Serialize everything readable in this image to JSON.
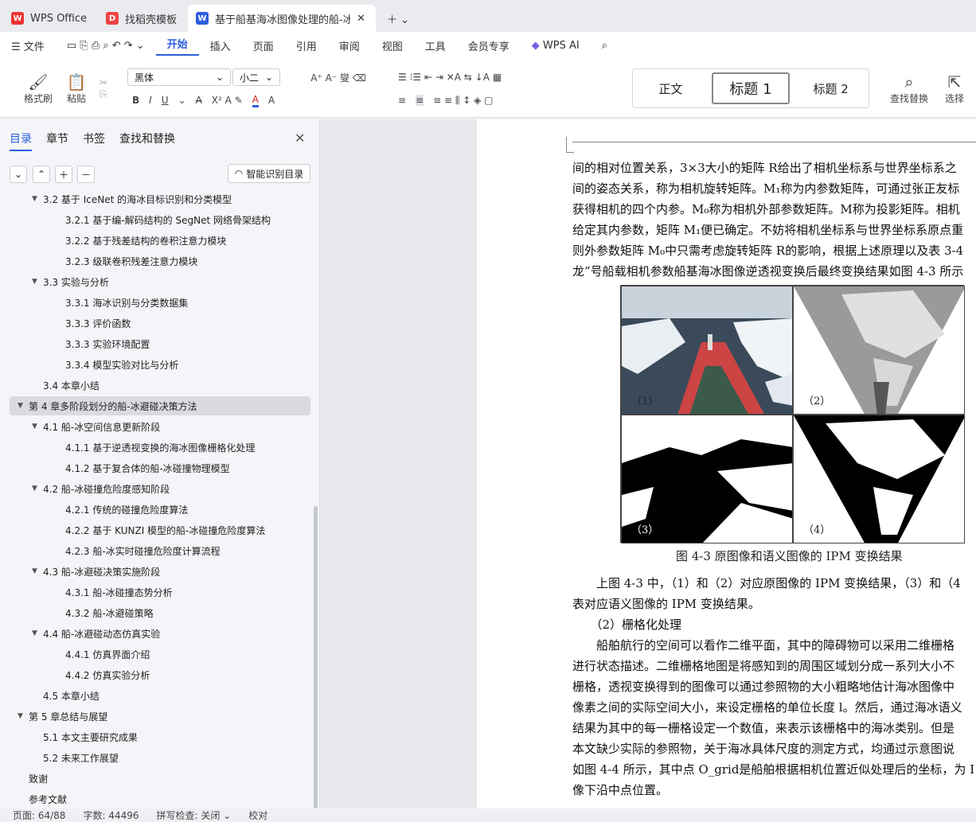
{
  "tabs": [
    {
      "label": "WPS Office"
    },
    {
      "label": "找稻壳模板"
    },
    {
      "label": "基于船基海冰图像处理的船-冰"
    }
  ],
  "menu": {
    "file": "文件",
    "items": [
      "开始",
      "插入",
      "页面",
      "引用",
      "审阅",
      "视图",
      "工具",
      "会员专享"
    ],
    "ai": "WPS AI"
  },
  "ribbon": {
    "format_painter": "格式刷",
    "paste": "粘贴",
    "font": "黑体",
    "size": "小二",
    "styles": [
      "正文",
      "标题 1",
      "标题 2"
    ],
    "find_replace": "查找替换",
    "select": "选择"
  },
  "sidebar": {
    "tabs": [
      "目录",
      "章节",
      "书签",
      "查找和替换"
    ],
    "smart": "智能识别目录",
    "items": [
      {
        "t": "3.2 基于 IceNet 的海冰目标识别和分类模型",
        "lvl": 2,
        "arr": "▼"
      },
      {
        "t": "3.2.1 基于编-解码结构的 SegNet 网络骨架结构",
        "lvl": 3
      },
      {
        "t": "3.2.2 基于残差结构的卷积注意力模块",
        "lvl": 3
      },
      {
        "t": "3.2.3 级联卷积残差注意力模块",
        "lvl": 3
      },
      {
        "t": "3.3 实验与分析",
        "lvl": 2,
        "arr": "▼"
      },
      {
        "t": "3.3.1 海冰识别与分类数据集",
        "lvl": 3
      },
      {
        "t": "3.3.3 评价函数",
        "lvl": 3
      },
      {
        "t": "3.3.3 实验环境配置",
        "lvl": 3
      },
      {
        "t": "3.3.4 模型实验对比与分析",
        "lvl": 3
      },
      {
        "t": "3.4 本章小结",
        "lvl": 2
      },
      {
        "t": "第 4 章多阶段划分的船-冰避碰决策方法",
        "lvl": 1,
        "arr": "▼",
        "sel": true
      },
      {
        "t": "4.1 船-冰空间信息更新阶段",
        "lvl": 2,
        "arr": "▼"
      },
      {
        "t": "4.1.1 基于逆透视变换的海冰图像栅格化处理",
        "lvl": 3
      },
      {
        "t": "4.1.2 基于复合体的船-冰碰撞物理模型",
        "lvl": 3
      },
      {
        "t": "4.2 船-冰碰撞危险度感知阶段",
        "lvl": 2,
        "arr": "▼"
      },
      {
        "t": "4.2.1 传统的碰撞危险度算法",
        "lvl": 3
      },
      {
        "t": "4.2.2 基于 KUNZI 模型的船-冰碰撞危险度算法",
        "lvl": 3
      },
      {
        "t": "4.2.3 船-冰实时碰撞危险度计算流程",
        "lvl": 3
      },
      {
        "t": "4.3 船-冰避碰决策实施阶段",
        "lvl": 2,
        "arr": "▼"
      },
      {
        "t": "4.3.1 船-冰碰撞态势分析",
        "lvl": 3
      },
      {
        "t": "4.3.2 船-冰避碰策略",
        "lvl": 3
      },
      {
        "t": "4.4 船-冰避碰动态仿真实验",
        "lvl": 2,
        "arr": "▼"
      },
      {
        "t": "4.4.1 仿真界面介绍",
        "lvl": 3
      },
      {
        "t": "4.4.2 仿真实验分析",
        "lvl": 3
      },
      {
        "t": "4.5 本章小结",
        "lvl": 2
      },
      {
        "t": "第 5 章总结与展望",
        "lvl": 1,
        "arr": "▼"
      },
      {
        "t": "5.1 本文主要研究成果",
        "lvl": 2
      },
      {
        "t": "5.2 未来工作展望",
        "lvl": 2
      },
      {
        "t": "致谢",
        "lvl": 1
      },
      {
        "t": "参考文献",
        "lvl": 1
      }
    ]
  },
  "doc": {
    "lines": [
      "间的相对位置关系，3×3大小的矩阵 R给出了相机坐标系与世界坐标系之",
      "间的姿态关系，称为相机旋转矩阵。M₁称为内参数矩阵，可通过张正友标",
      "获得相机的四个内参。M₀称为相机外部参数矩阵。M称为投影矩阵。相机",
      "给定其内参数，矩阵 M₁便已确定。不妨将相机坐标系与世界坐标系原点重",
      "则外参数矩阵 M₀中只需考虑旋转矩阵 R的影响，根据上述原理以及表 3-4",
      "龙”号船载相机参数船基海冰图像逆透视变换后最终变换结果如图 4-3 所示"
    ],
    "fig_labels": [
      "（1）",
      "（2）",
      "（3）",
      "（4）"
    ],
    "caption": "图 4-3 原图像和语义图像的 IPM 变换结果",
    "lines2": [
      "　　上图 4-3 中，（1）和（2）对应原图像的 IPM 变换结果，（3）和（4",
      "表对应语义图像的 IPM 变换结果。",
      "　　（2）栅格化处理",
      "　　船舶航行的空间可以看作二维平面，其中的障碍物可以采用二维栅格",
      "进行状态描述。二维栅格地图是将感知到的周围区域划分成一系列大小不",
      "栅格，透视变换得到的图像可以通过参照物的大小粗略地估计海冰图像中",
      "像素之间的实际空间大小，来设定栅格的单位长度 l。然后，通过海冰语义",
      "结果为其中的每一栅格设定一个数值，来表示该栅格中的海冰类别。但是",
      "本文缺少实际的参照物，关于海冰具体尺度的测定方式，均通过示意图说",
      "如图 4-4 所示，其中点 O_grid是船舶根据相机位置近似处理后的坐标，为 I",
      "像下沿中点位置。"
    ]
  },
  "status": {
    "page": "页面: 64/88",
    "words": "字数: 44496",
    "spell": "拼写检查: 关闭",
    "proof": "校对"
  }
}
